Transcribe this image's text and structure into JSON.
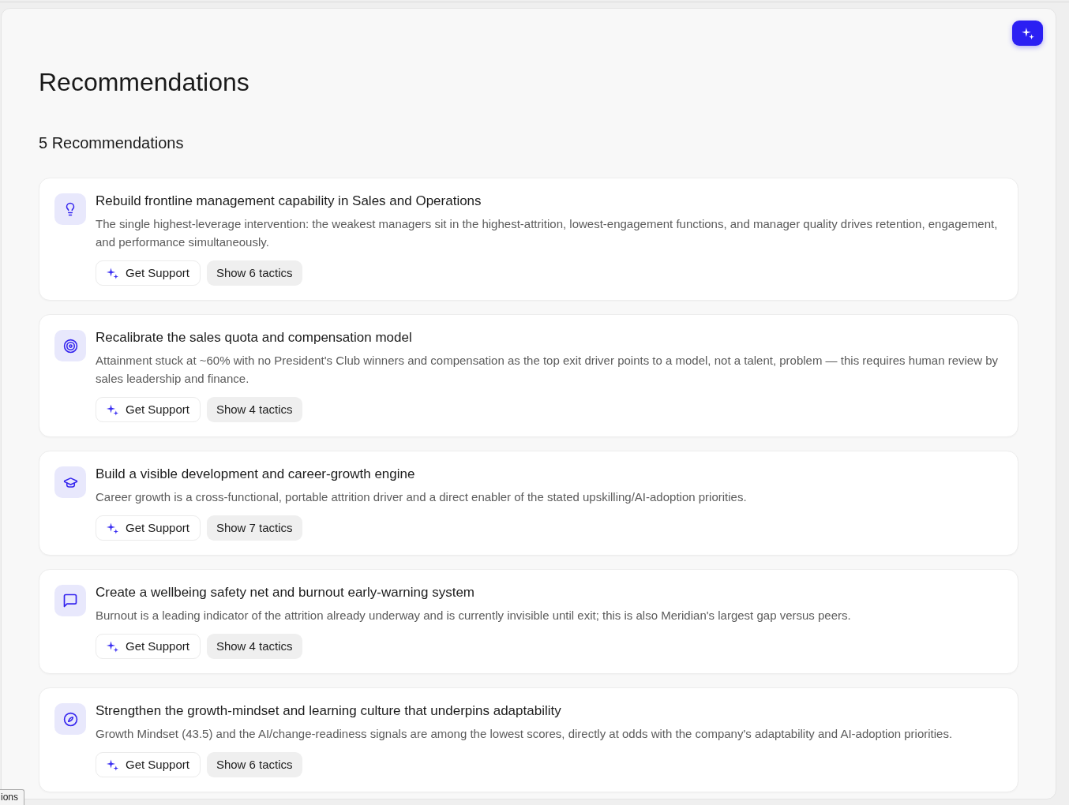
{
  "page": {
    "title": "Recommendations",
    "count_label": "5 Recommendations"
  },
  "recommendations": [
    {
      "title": "Rebuild frontline management capability in Sales and Operations",
      "description": "The single highest-leverage intervention: the weakest managers sit in the highest-attrition, lowest-engagement functions, and manager quality drives retention, engagement, and performance simultaneously.",
      "support_label": "Get Support",
      "tactics_label": "Show 6 tactics"
    },
    {
      "title": "Recalibrate the sales quota and compensation model",
      "description": "Attainment stuck at ~60% with no President's Club winners and compensation as the top exit driver points to a model, not a talent, problem — this requires human review by sales leadership and finance.",
      "support_label": "Get Support",
      "tactics_label": "Show 4 tactics"
    },
    {
      "title": "Build a visible development and career-growth engine",
      "description": "Career growth is a cross-functional, portable attrition driver and a direct enabler of the stated upskilling/AI-adoption priorities.",
      "support_label": "Get Support",
      "tactics_label": "Show 7 tactics"
    },
    {
      "title": "Create a wellbeing safety net and burnout early-warning system",
      "description": "Burnout is a leading indicator of the attrition already underway and is currently invisible until exit; this is also Meridian's largest gap versus peers.",
      "support_label": "Get Support",
      "tactics_label": "Show 4 tactics"
    },
    {
      "title": "Strengthen the growth-mindset and learning culture that underpins adaptability",
      "description": "Growth Mindset (43.5) and the AI/change-readiness signals are among the lowest scores, directly at odds with the company's adaptability and AI-adoption priorities.",
      "support_label": "Get Support",
      "tactics_label": "Show 6 tactics"
    }
  ],
  "corner_tab": {
    "label": "ions"
  }
}
